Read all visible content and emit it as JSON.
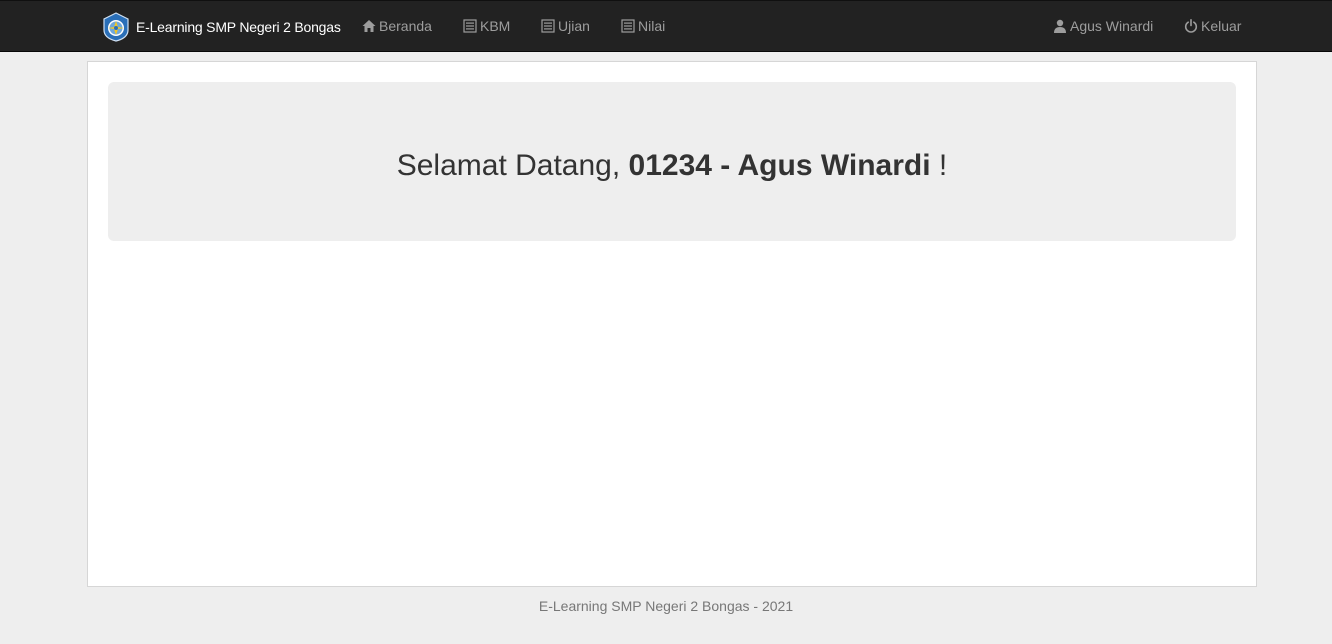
{
  "navbar": {
    "brand": "E-Learning SMP Negeri 2 Bongas",
    "logo_icon": "tut-wuri-handayani-logo",
    "items": [
      {
        "label": "Beranda",
        "icon": "home-icon"
      },
      {
        "label": "KBM",
        "icon": "list-icon"
      },
      {
        "label": "Ujian",
        "icon": "list-icon"
      },
      {
        "label": "Nilai",
        "icon": "list-icon"
      }
    ],
    "user": {
      "label": "Agus Winardi",
      "icon": "user-icon"
    },
    "logout": {
      "label": "Keluar",
      "icon": "power-icon"
    }
  },
  "main": {
    "welcome_prefix": "Selamat Datang, ",
    "welcome_name": "01234 - Agus Winardi",
    "welcome_suffix": " !"
  },
  "footer": {
    "text": "E-Learning SMP Negeri 2 Bongas - 2021"
  },
  "colors": {
    "navbar_bg": "#222222",
    "nav_text": "#9d9d9d",
    "brand_text": "#ffffff",
    "page_bg": "#eeeeee",
    "logo_blue": "#2a6fb8",
    "logo_yellow": "#f3c623"
  }
}
